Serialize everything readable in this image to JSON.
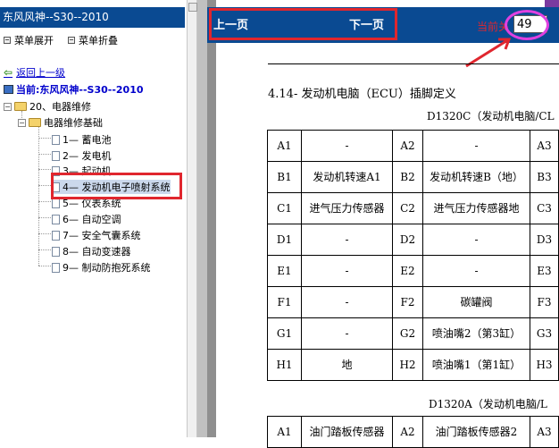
{
  "sidebar": {
    "title": "东风风神--S30--2010",
    "expand_label": "菜单展开",
    "collapse_label": "菜单折叠",
    "back_label": "返回上一级",
    "current_label": "当前:东风风神--S30--2010",
    "tree": {
      "level1": "20、电器维修",
      "level2": "电器维修基础",
      "items": [
        "1— 蓄电池",
        "2— 发电机",
        "3— 起动机",
        "4— 发动机电子喷射系统",
        "5— 仪表系统",
        "6— 自动空调",
        "7— 安全气囊系统",
        "8— 自动变速器",
        "9— 制动防抱死系统"
      ]
    }
  },
  "topnav": {
    "prev_label": "上一页",
    "next_label": "下一页",
    "page_label": "当前关",
    "page_value": "49"
  },
  "document": {
    "section_title": "4.14-  发动机电脑（ECU）插脚定义",
    "table1_caption": "D1320C（发动机电脑/CL",
    "table1_rows": [
      [
        "A1",
        "-",
        "A2",
        "-",
        "A3"
      ],
      [
        "B1",
        "发动机转速A1",
        "B2",
        "发动机转速B（地）",
        "B3"
      ],
      [
        "C1",
        "进气压力传感器",
        "C2",
        "进气压力传感器地",
        "C3"
      ],
      [
        "D1",
        "-",
        "D2",
        "-",
        "D3"
      ],
      [
        "E1",
        "-",
        "E2",
        "-",
        "E3"
      ],
      [
        "F1",
        "-",
        "F2",
        "碳罐阀",
        "F3"
      ],
      [
        "G1",
        "-",
        "G2",
        "喷油嘴2（第3缸）",
        "G3"
      ],
      [
        "H1",
        "地",
        "H2",
        "喷油嘴1（第1缸）",
        "H3"
      ]
    ],
    "table2_caption": "D1320A（发动机电脑/L",
    "table2_rows": [
      [
        "A1",
        "油门踏板传感器",
        "A2",
        "油门踏板传感器2",
        "A3"
      ]
    ]
  },
  "colors": {
    "header_blue": "#0a4a92",
    "annotation_red": "#e0262e",
    "annotation_magenta": "#e040e0"
  }
}
